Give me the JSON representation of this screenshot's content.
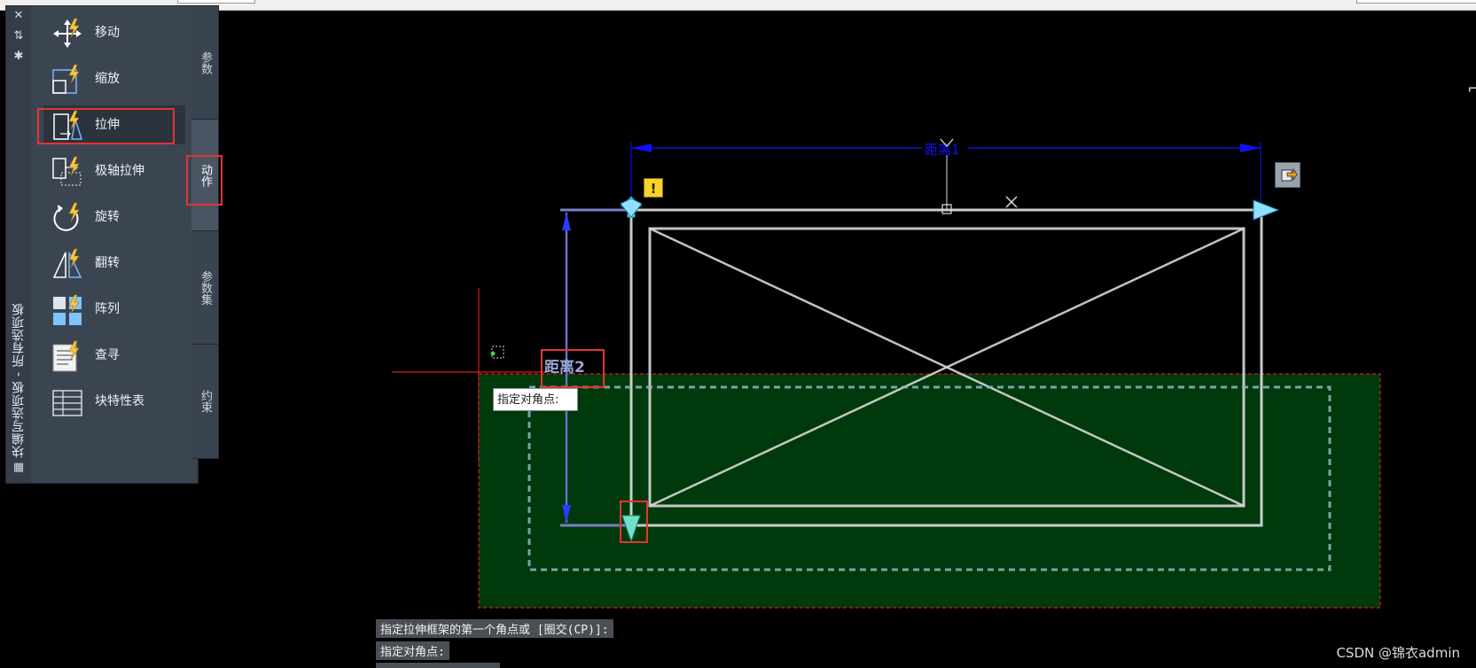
{
  "palette": {
    "title": "块编写选项板 - 所有选项板",
    "items": [
      {
        "label": "移动",
        "icon": "move-icon"
      },
      {
        "label": "缩放",
        "icon": "scale-icon"
      },
      {
        "label": "拉伸",
        "icon": "stretch-icon"
      },
      {
        "label": "极轴拉伸",
        "icon": "polar-stretch-icon"
      },
      {
        "label": "旋转",
        "icon": "rotate-icon"
      },
      {
        "label": "翻转",
        "icon": "flip-icon"
      },
      {
        "label": "阵列",
        "icon": "array-icon"
      },
      {
        "label": "查寻",
        "icon": "lookup-icon"
      },
      {
        "label": "块特性表",
        "icon": "block-table-icon"
      }
    ],
    "tabs": [
      {
        "label": "参数"
      },
      {
        "label": "动作"
      },
      {
        "label": "参数集"
      },
      {
        "label": "约束"
      }
    ],
    "selected_item": "拉伸",
    "active_tab": "动作"
  },
  "canvas": {
    "param_distance1": "距离1",
    "param_distance2": "距离2",
    "tooltip": "指定对角点:",
    "warning_mark": "!",
    "cmd_line1": "指定拉伸框架的第一个角点或 [圈交(CP)]:",
    "cmd_line2": "指定对角点:"
  },
  "watermark": "CSDN @锦衣admin",
  "colors": {
    "palette_bg": "#3a4350",
    "highlight_red": "#e53333",
    "selection_fill": "#003a0c",
    "dimension_blue": "#1010ff",
    "grip_cyan": "#8fe0ff"
  }
}
